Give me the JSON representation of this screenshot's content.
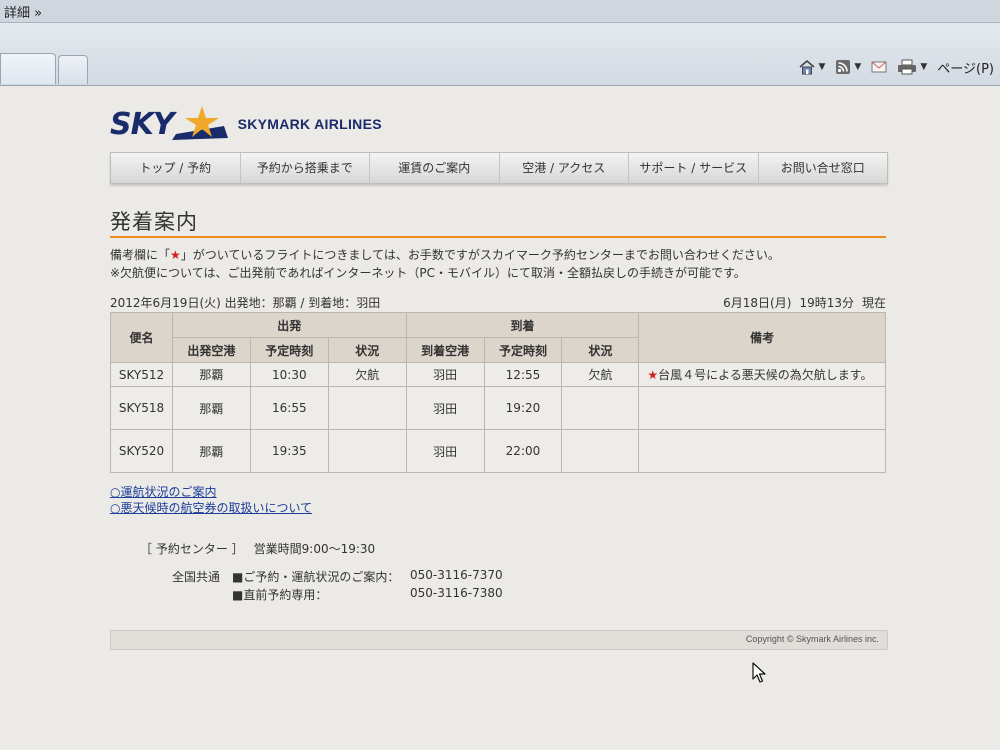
{
  "browser": {
    "details_label": "詳細 »",
    "command_bar": {
      "icons": [
        "home-icon",
        "rss-feed-icon",
        "mail-icon",
        "print-icon"
      ],
      "page_menu_label": "ページ(P)"
    }
  },
  "site": {
    "logo_mark": "SKY",
    "logo_name": "SKYMARK AIRLINES",
    "nav": [
      "トップ / 予約",
      "予約から搭乗まで",
      "運賃のご案内",
      "空港 / アクセス",
      "サポート / サービス",
      "お問い合せ窓口"
    ]
  },
  "main": {
    "title": "発着案内",
    "notice_line1_pre": "備考欄に「",
    "notice_star": "★",
    "notice_line1_post": "」がついているフライトにつきましては、お手数ですがスカイマーク予約センターまでお問い合わせください。",
    "notice_line2": "※欠航便については、ご出発前であればインターネット（PC・モバイル）にて取消・全額払戻しの手続きが可能です。",
    "date_left": "2012年6月19日(火)  出発地：那覇  /  到着地：羽田",
    "date_right_date": "6月18日(月)",
    "date_right_time": "19時13分",
    "date_right_now": "現在",
    "table": {
      "header_flight": "便名",
      "header_departure": "出発",
      "header_arrival": "到着",
      "header_remarks": "備考",
      "sub_dep_airport": "出発空港",
      "sub_dep_time": "予定時刻",
      "sub_dep_status": "状況",
      "sub_arr_airport": "到着空港",
      "sub_arr_time": "予定時刻",
      "sub_arr_status": "状況",
      "rows": [
        {
          "flight": "SKY512",
          "dep_airport": "那覇",
          "dep_time": "10:30",
          "dep_status": "欠航",
          "arr_airport": "羽田",
          "arr_time": "12:55",
          "arr_status": "欠航",
          "remark_star": "★",
          "remark": "台風４号による悪天候の為欠航します。"
        },
        {
          "flight": "SKY518",
          "dep_airport": "那覇",
          "dep_time": "16:55",
          "dep_status": "",
          "arr_airport": "羽田",
          "arr_time": "19:20",
          "arr_status": "",
          "remark_star": "",
          "remark": ""
        },
        {
          "flight": "SKY520",
          "dep_airport": "那覇",
          "dep_time": "19:35",
          "dep_status": "",
          "arr_airport": "羽田",
          "arr_time": "22:00",
          "arr_status": "",
          "remark_star": "",
          "remark": ""
        }
      ]
    },
    "links": [
      "○運航状況のご案内",
      "○悪天候時の航空券の取扱いについて"
    ],
    "reservation": {
      "title": "［ 予約センター ］",
      "hours": "営業時間9:00～19:30",
      "scope": "全国共通",
      "line1_label": "■ご予約・運航状況のご案内：",
      "line1_tel": "050-3116-7370",
      "line2_label": "■直前予約専用：",
      "line2_tel": "050-3116-7380"
    },
    "copyright": "Copyright © Skymark Airlines inc."
  },
  "colors": {
    "brand_navy": "#1a2b6b",
    "brand_star": "#f0a92a",
    "title_rule": "#ee8a1e",
    "alert_star": "#d41f1f",
    "link": "#1b3e9a"
  }
}
